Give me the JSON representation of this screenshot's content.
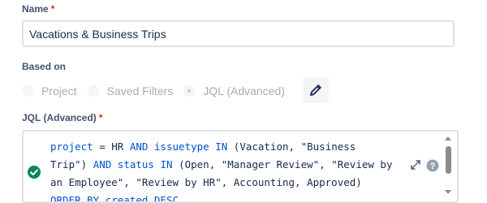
{
  "name_field": {
    "label": "Name",
    "required_mark": "*",
    "value": "Vacations & Business Trips"
  },
  "based_on": {
    "label": "Based on",
    "options": [
      {
        "label": "Project",
        "selected": false
      },
      {
        "label": "Saved Filters",
        "selected": false
      },
      {
        "label": "JQL (Advanced)",
        "selected": true
      }
    ],
    "edit_icon": "pencil-icon"
  },
  "jql_field": {
    "label": "JQL (Advanced)",
    "required_mark": "*",
    "query_lines": [
      [
        {
          "t": "project",
          "kw": true
        },
        {
          "t": " = HR ",
          "kw": false
        },
        {
          "t": "AND",
          "kw": true
        },
        {
          "t": " ",
          "kw": false
        },
        {
          "t": "issuetype",
          "kw": true
        },
        {
          "t": " ",
          "kw": false
        },
        {
          "t": "IN",
          "kw": true
        },
        {
          "t": " (Vacation, \"Business",
          "kw": false
        }
      ],
      [
        {
          "t": "Trip\") ",
          "kw": false
        },
        {
          "t": "AND",
          "kw": true
        },
        {
          "t": " ",
          "kw": false
        },
        {
          "t": "status",
          "kw": true
        },
        {
          "t": " ",
          "kw": false
        },
        {
          "t": "IN",
          "kw": true
        },
        {
          "t": " (Open, \"Manager Review\", \"Review by",
          "kw": false
        }
      ],
      [
        {
          "t": "an Employee\", \"Review by HR\", Accounting, Approved)",
          "kw": false
        }
      ],
      [
        {
          "t": "ORDER BY created DESC",
          "kw": true
        }
      ]
    ],
    "valid_icon": "check-circle-icon",
    "expand_icon": "expand-icon",
    "help_icon": "help-icon",
    "colors": {
      "keyword": "#0052cc",
      "valid": "#00875a"
    }
  }
}
